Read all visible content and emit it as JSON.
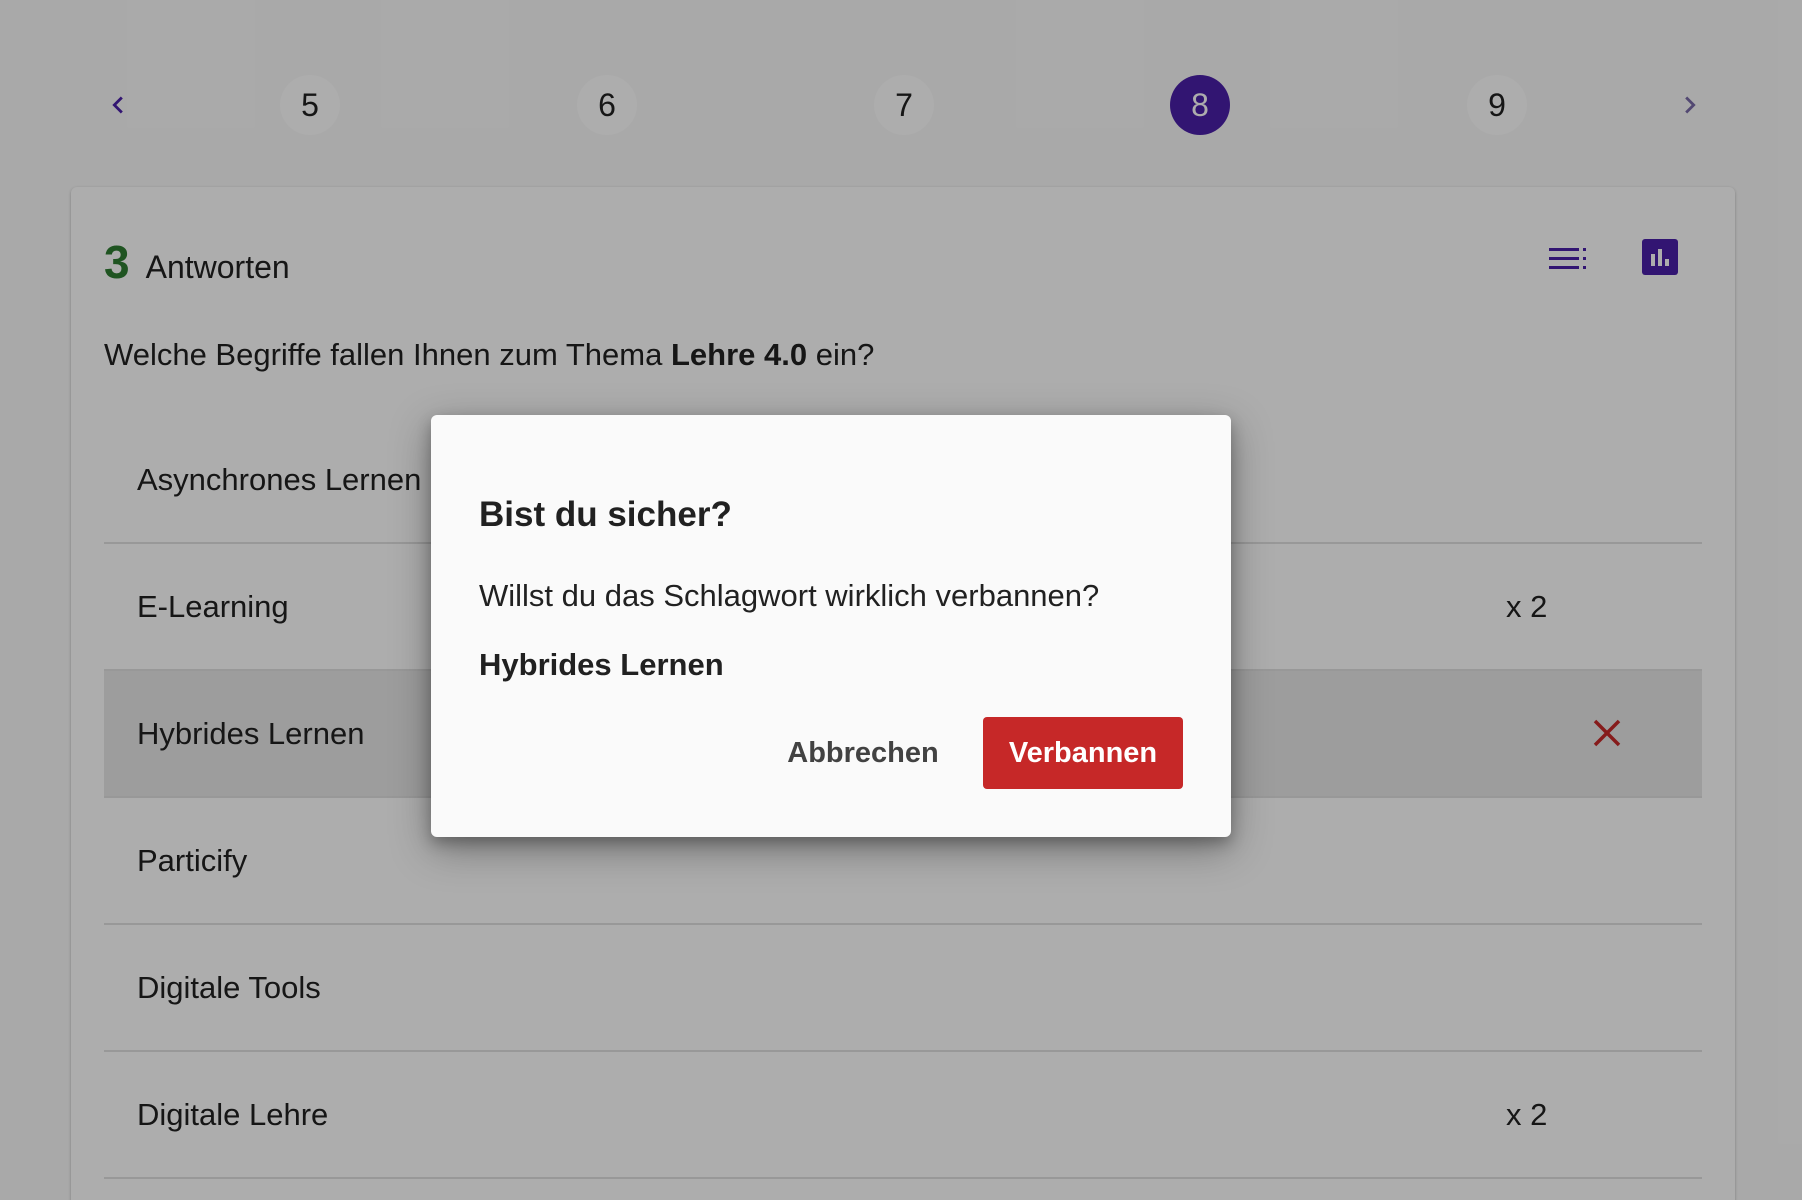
{
  "pagination": {
    "pages": [
      "5",
      "6",
      "7",
      "8",
      "9"
    ],
    "active_page": "8",
    "prev_icon": "chevron-left-icon",
    "next_icon": "chevron-right-icon"
  },
  "card": {
    "count": "3",
    "count_label": "Antworten",
    "view_icons": [
      "list-view-icon",
      "bar-chart-icon"
    ],
    "question_prefix": "Welche Begriffe fallen Ihnen zum Thema",
    "question_bold": "Lehre 4.0",
    "question_suffix": "ein?",
    "answers": [
      {
        "text": "Asynchrones Lernen",
        "count": ""
      },
      {
        "text": "E-Learning",
        "count": "x 2"
      },
      {
        "text": "Hybrides Lernen",
        "count": "",
        "remove_icon": "close-icon"
      },
      {
        "text": "Particify",
        "count": ""
      },
      {
        "text": "Digitale Tools",
        "count": ""
      },
      {
        "text": "Digitale Lehre",
        "count": "x 2"
      }
    ]
  },
  "dialog": {
    "title": "Bist du sicher?",
    "message": "Willst du das Schlagwort wirklich verbannen?",
    "term": "Hybrides Lernen",
    "cancel_label": "Abbrechen",
    "confirm_label": "Verbannen"
  },
  "colors": {
    "accent": "#4a1fa8",
    "count_green": "#2e7d32",
    "danger": "#c62828"
  }
}
